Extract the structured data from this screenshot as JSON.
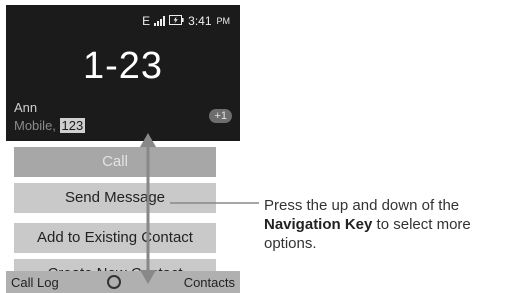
{
  "status_bar": {
    "network": "E",
    "signal_icon": "signal-bars-icon",
    "battery_icon": "battery-charging-icon",
    "time": "3:41",
    "ampm": "PM"
  },
  "call": {
    "number": "1-23",
    "contact_name": "Ann",
    "number_type": "Mobile,",
    "highlight": "123",
    "badge": "+1"
  },
  "menu": {
    "items": [
      {
        "label": "Call",
        "selected": true
      },
      {
        "label": "Send Message",
        "selected": false
      },
      {
        "label": "Add to Existing Contact",
        "selected": false
      },
      {
        "label": "Create New Contact",
        "selected": false
      }
    ]
  },
  "softkeys": {
    "left": "Call Log",
    "center_icon": "center-circle-icon",
    "right": "Contacts"
  },
  "callout": {
    "part1": "Press the up and down of the",
    "bold": "Navigation Key",
    "part2": "to select more options."
  },
  "colors": {
    "screen_dark": "#1b1b1b",
    "menu_button": "#c9c9c9",
    "menu_selected": "#a7a7a7",
    "softkey_bar": "#b0b0b0",
    "arrow": "#888888"
  }
}
